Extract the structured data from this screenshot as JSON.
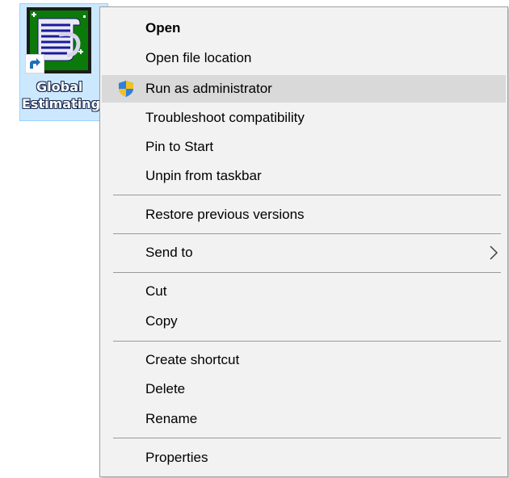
{
  "desktop_icon": {
    "label_line1": "Global",
    "label_line2": "Estimating",
    "icon": "global-estimating-app-icon",
    "overlay_icon": "shortcut-arrow-icon",
    "selection_color": "#cce8ff"
  },
  "context_menu": {
    "items": [
      {
        "label": "Open",
        "bold": true
      },
      {
        "label": "Open file location"
      },
      {
        "label": "Run as administrator",
        "icon": "uac-shield-icon",
        "highlighted": true
      },
      {
        "label": "Troubleshoot compatibility"
      },
      {
        "label": "Pin to Start"
      },
      {
        "label": "Unpin from taskbar"
      },
      {
        "label": "Restore previous versions"
      },
      {
        "label": "Send to",
        "submenu_icon": "chevron-right-icon"
      },
      {
        "label": "Cut"
      },
      {
        "label": "Copy"
      },
      {
        "label": "Create shortcut"
      },
      {
        "label": "Delete"
      },
      {
        "label": "Rename"
      },
      {
        "label": "Properties"
      }
    ],
    "colors": {
      "background": "#f2f2f2",
      "hover": "#d9d9d9",
      "separator": "#9a9a9a",
      "text": "#000000"
    }
  }
}
